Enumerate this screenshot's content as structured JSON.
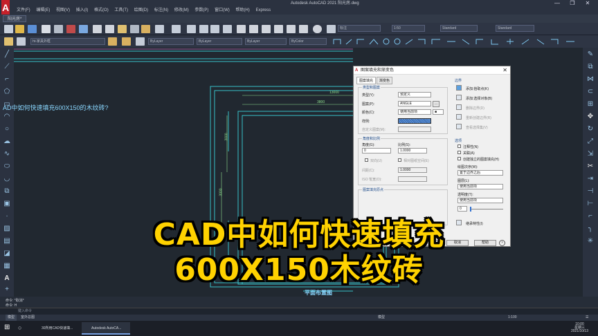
{
  "app": {
    "title": "Autodesk AutoCAD 2021   阳光房.dwg",
    "logo": "A",
    "window_controls": [
      "—",
      "❐",
      "✕"
    ]
  },
  "menubar": [
    "文件(F)",
    "编辑(E)",
    "视图(V)",
    "插入(I)",
    "格式(O)",
    "工具(T)",
    "绘图(D)",
    "标注(N)",
    "修改(M)",
    "参数(P)",
    "窗口(W)",
    "帮助(H)",
    "Express"
  ],
  "tabs": {
    "document": "阳光房*"
  },
  "toolbar": {
    "style_standard": "标注",
    "scale": "1:50",
    "table_style": "Standard",
    "mleader_style": "Standard",
    "layer": "ht-家具外框",
    "color": "ByLayer",
    "linetype": "ByLayer",
    "lineweight": "ByLayer",
    "plotstyle": "ByColor"
  },
  "canvas": {
    "question": "AD中如何快速填充600X150的木纹砖?",
    "dim_1": "13000",
    "dim_2": "3800",
    "dim_3": "12000",
    "dim_4": "3000",
    "dim_5": "3000",
    "plan_label": "平面布置图"
  },
  "caption": {
    "line1": "CAD中如何快速填充",
    "line2": "600X150木纹砖"
  },
  "dialog": {
    "title": "图案填充和渐变色",
    "tabs": [
      "图案填充",
      "渐变色"
    ],
    "type_pattern_group": "类型和图案",
    "type_label": "类型(Y):",
    "type_value": "预定义",
    "pattern_label": "图案(P):",
    "pattern_value": "ANGLE",
    "color_label": "颜色(C):",
    "color_value": "使用当前项",
    "sample_label": "样例:",
    "custom_label": "自定义图案(M):",
    "angle_scale_group": "角度和比例",
    "angle_label": "角度(G):",
    "angle_value": "0",
    "scale_label": "比例(S):",
    "scale_value": "1.0000",
    "double_label": "双向(U)",
    "relative_label": "相对图纸空间(E)",
    "spacing_label": "间距(C):",
    "spacing_value": "1.0000",
    "iso_label": "ISO 笔宽(O):",
    "origin_group": "图案填充原点",
    "boundary_group": "边界",
    "add_pick": "添加:拾取点(K)",
    "add_select": "添加:选择对象(B)",
    "remove_boundary": "删除边界(D)",
    "recreate_boundary": "重新创建边界(R)",
    "view_selection": "查看选择集(V)",
    "options_group": "选项",
    "annotative": "注释性(N)",
    "associative": "关联(A)",
    "separate": "创建独立的图案填充(H)",
    "draw_order_label": "绘图次序(W):",
    "draw_order_value": "置于边界之后",
    "layer_label": "图层(L):",
    "layer_value": "使用当前项",
    "transparency_label": "透明度(T):",
    "transparency_value": "使用当前项",
    "transparency_num": "0",
    "inherit": "继承特性(I)",
    "store_default": "存储为默认原点(F)",
    "btn_ok": "确定",
    "btn_cancel": "取消",
    "btn_help": "帮助"
  },
  "command": {
    "hist1": "命令: *取消*",
    "hist2": "命令: H",
    "prompt": "键入命令"
  },
  "status": {
    "model_tab": "模型",
    "layout_tab": "室外总图",
    "model_btn": "模型",
    "scale": "1:100"
  },
  "taskbar": {
    "task1": "30所用CAD快速填...",
    "task2": "Autodesk AutoCA...",
    "time": "10:00",
    "weekday": "星期三",
    "date": "2021/10/13"
  },
  "colors": {
    "accent": "#ffd200",
    "drawing_lines": "#38c0c8",
    "dim_text": "#8fe08f"
  }
}
